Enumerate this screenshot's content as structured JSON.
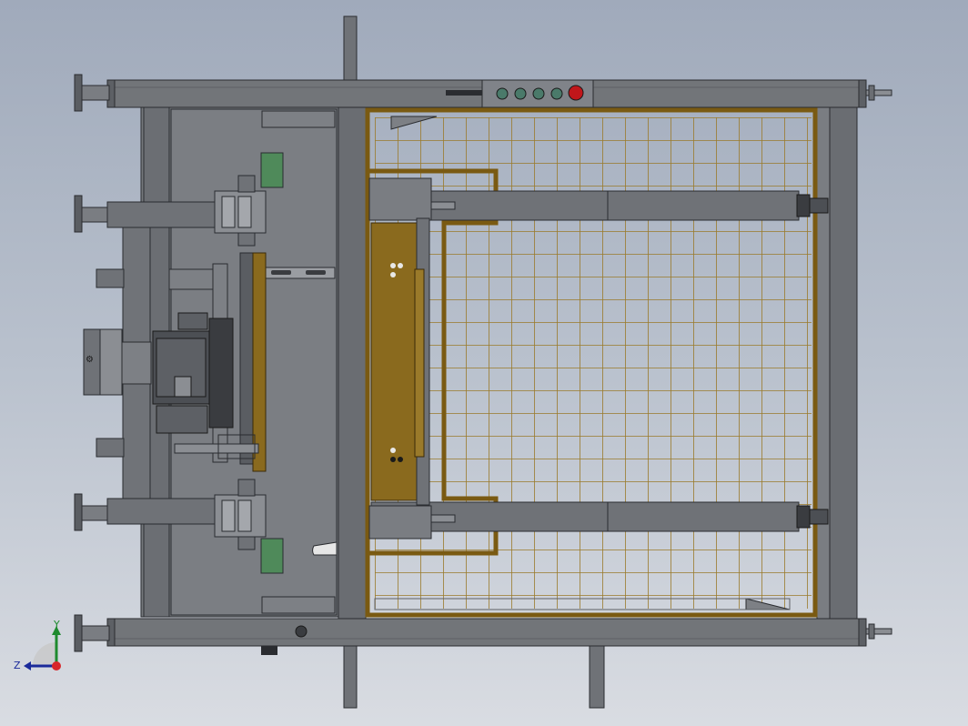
{
  "viewport": {
    "title": "",
    "background_top": "#a0aabb",
    "background_bottom": "#d9dce2"
  },
  "colors": {
    "steel": "#6f7277",
    "steel_light": "#8b8e93",
    "steel_dark": "#4c4f54",
    "outline": "#2a2c30",
    "fence_frame": "#7a5a12",
    "fence_mesh": "#9a7a2a",
    "bracket": "#8a6a1e",
    "green_block": "#4f8a5a",
    "stop_button": "#c0161a"
  },
  "control_panel": {
    "button_count": 4,
    "stop_button": true
  },
  "mesh": {
    "columns": 21,
    "rows": 18
  },
  "triad": {
    "x_label": "",
    "y_label": "Y",
    "z_label": "Z"
  }
}
